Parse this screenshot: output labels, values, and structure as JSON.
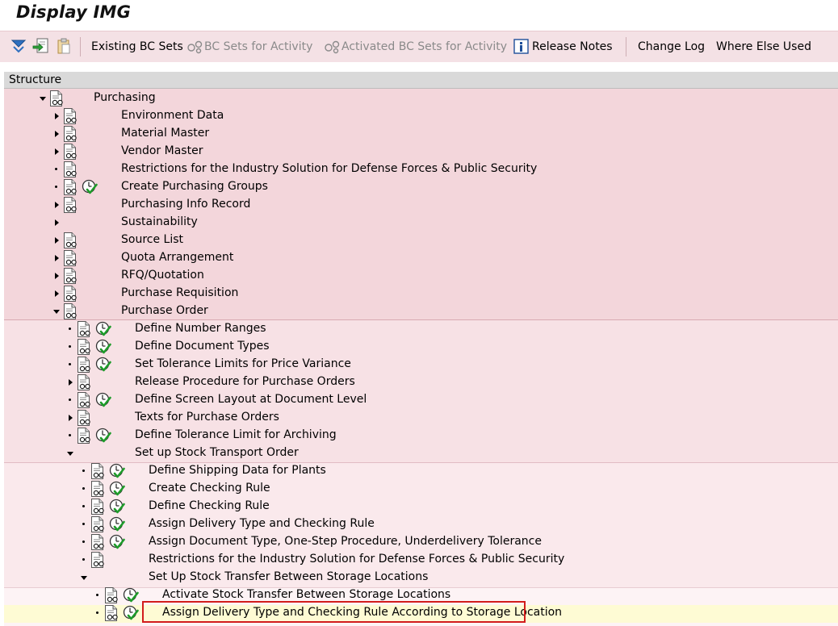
{
  "window": {
    "title": "Display IMG"
  },
  "toolbar": {
    "existing_bc_sets": "Existing BC Sets",
    "bc_sets_for_activity": "BC Sets for Activity",
    "activated_bc_sets": "Activated BC Sets for Activity",
    "release_notes": "Release Notes",
    "change_log": "Change Log",
    "where_else_used": "Where Else Used"
  },
  "structure": {
    "header": "Structure",
    "root": "Purchasing",
    "level1": [
      "Environment Data",
      "Material Master",
      "Vendor Master",
      "Restrictions for the Industry Solution for Defense Forces & Public Security",
      "Create Purchasing Groups",
      "Purchasing Info Record",
      "Sustainability",
      "Source List",
      "Quota Arrangement",
      "RFQ/Quotation",
      "Purchase Requisition",
      "Purchase Order"
    ],
    "purchase_order": [
      "Define Number Ranges",
      "Define Document Types",
      "Set Tolerance Limits for Price Variance",
      "Release Procedure for Purchase Orders",
      "Define Screen Layout at Document Level",
      "Texts for Purchase Orders",
      "Define Tolerance Limit for Archiving",
      "Set up Stock Transport Order"
    ],
    "stock_transport": [
      "Define Shipping Data for Plants",
      "Create Checking Rule",
      "Define Checking Rule",
      "Assign Delivery Type and Checking Rule",
      "Assign Document Type, One-Step Procedure, Underdelivery Tolerance",
      "Restrictions for the Industry Solution for Defense Forces & Public Security",
      "Set Up Stock Transfer Between Storage Locations"
    ],
    "storage_transfer": [
      "Activate Stock Transfer Between Storage Locations",
      "Assign Delivery Type and Checking Rule According to Storage Location"
    ]
  },
  "colors": {
    "toolbar_bg": "#f4e1e5",
    "level1_bg": "#f3d6db",
    "level2_bg": "#f7e1e5",
    "level3_bg": "#fae9ec",
    "selected_bg": "#fefbd4",
    "highlight_border": "#d21c1c"
  }
}
